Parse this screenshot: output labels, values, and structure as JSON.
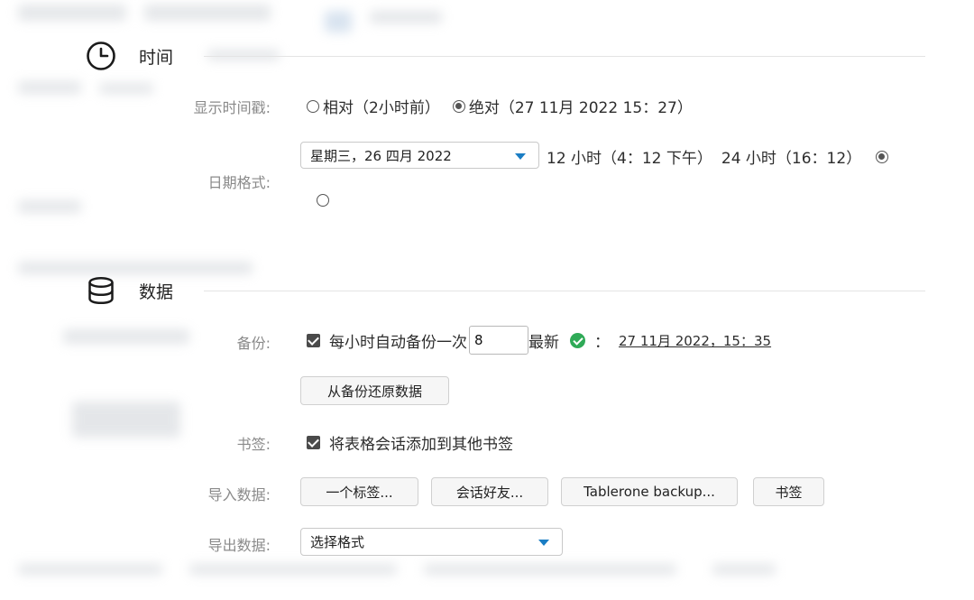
{
  "time_section": {
    "title": "时间",
    "icon": "clock-icon",
    "timestamp": {
      "label": "显示时间戳:",
      "relative": "相对（2小时前）",
      "absolute": "绝对（27 11月 2022 15：27）",
      "selected": "absolute"
    },
    "date_format": {
      "label": "日期格式:",
      "selected_value": "星期三，26 四月 2022",
      "hour12": "12 小时（4：12 下午）",
      "hour24": "24 小时（16：12）",
      "hour24_selected": true,
      "hour12_selected": false
    }
  },
  "data_section": {
    "title": "数据",
    "icon": "database-icon",
    "backup": {
      "label": "备份:",
      "checkbox_text": "每小时自动备份一次",
      "checked": true,
      "count": "8",
      "latest_label": "最新",
      "separator": "：",
      "latest_time": "27 11月 2022，15：35",
      "restore_button": "从备份还原数据"
    },
    "bookmarks": {
      "label": "书签:",
      "checkbox_text": "将表格会话添加到其他书签",
      "checked": true
    },
    "import": {
      "label": "导入数据:",
      "buttons": [
        "一个标签...",
        "会话好友...",
        "Tablerone backup...",
        "书签"
      ]
    },
    "export": {
      "label": "导出数据:",
      "select_value": "选择格式"
    }
  },
  "colors": {
    "accent": "#1a7dc4",
    "success": "#2faa57"
  }
}
